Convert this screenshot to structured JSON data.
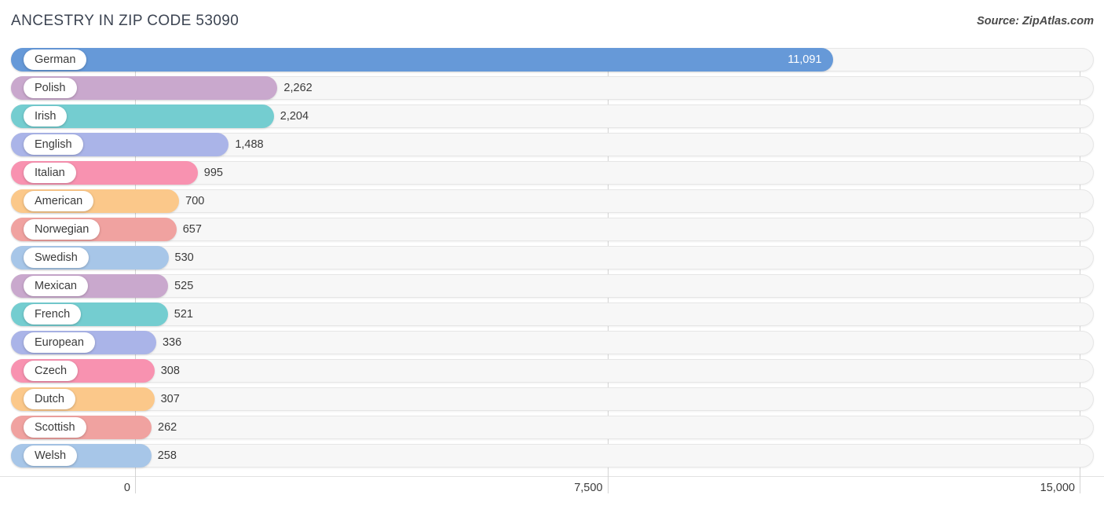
{
  "header": {
    "title": "ANCESTRY IN ZIP CODE 53090",
    "source": "Source: ZipAtlas.com"
  },
  "chart_data": {
    "type": "bar",
    "orientation": "horizontal",
    "title": "ANCESTRY IN ZIP CODE 53090",
    "xlabel": "",
    "ylabel": "",
    "xlim": [
      0,
      15000
    ],
    "xticks": [
      0,
      7500,
      15000
    ],
    "xtick_labels": [
      "0",
      "7,500",
      "15,000"
    ],
    "grid": true,
    "legend": "none",
    "categories": [
      "German",
      "Polish",
      "Irish",
      "English",
      "Italian",
      "American",
      "Norwegian",
      "Swedish",
      "Mexican",
      "French",
      "European",
      "Czech",
      "Dutch",
      "Scottish",
      "Welsh"
    ],
    "values": [
      11091,
      2262,
      2204,
      1488,
      995,
      700,
      657,
      530,
      525,
      521,
      336,
      308,
      307,
      262,
      258
    ],
    "value_labels": [
      "11,091",
      "2,262",
      "2,204",
      "1,488",
      "995",
      "700",
      "657",
      "530",
      "525",
      "521",
      "336",
      "308",
      "307",
      "262",
      "258"
    ],
    "colors": [
      "#6699d8",
      "#c9a8cd",
      "#74cdd0",
      "#aab4e8",
      "#f892b0",
      "#fbc88a",
      "#f0a2a0",
      "#a7c6e8",
      "#c9a8cd",
      "#74cdd0",
      "#aab4e8",
      "#f892b0",
      "#fbc88a",
      "#f0a2a0",
      "#a7c6e8"
    ],
    "bars": [
      {
        "label": "German",
        "value": 11091,
        "value_label": "11,091",
        "color": "#6699d8",
        "label_inside": true
      },
      {
        "label": "Polish",
        "value": 2262,
        "value_label": "2,262",
        "color": "#c9a8cd",
        "label_inside": false
      },
      {
        "label": "Irish",
        "value": 2204,
        "value_label": "2,204",
        "color": "#74cdd0",
        "label_inside": false
      },
      {
        "label": "English",
        "value": 1488,
        "value_label": "1,488",
        "color": "#aab4e8",
        "label_inside": false
      },
      {
        "label": "Italian",
        "value": 995,
        "value_label": "995",
        "color": "#f892b0",
        "label_inside": false
      },
      {
        "label": "American",
        "value": 700,
        "value_label": "700",
        "color": "#fbc88a",
        "label_inside": false
      },
      {
        "label": "Norwegian",
        "value": 657,
        "value_label": "657",
        "color": "#f0a2a0",
        "label_inside": false
      },
      {
        "label": "Swedish",
        "value": 530,
        "value_label": "530",
        "color": "#a7c6e8",
        "label_inside": false
      },
      {
        "label": "Mexican",
        "value": 525,
        "value_label": "525",
        "color": "#c9a8cd",
        "label_inside": false
      },
      {
        "label": "French",
        "value": 521,
        "value_label": "521",
        "color": "#74cdd0",
        "label_inside": false
      },
      {
        "label": "European",
        "value": 336,
        "value_label": "336",
        "color": "#aab4e8",
        "label_inside": false
      },
      {
        "label": "Czech",
        "value": 308,
        "value_label": "308",
        "color": "#f892b0",
        "label_inside": false
      },
      {
        "label": "Dutch",
        "value": 307,
        "value_label": "307",
        "color": "#fbc88a",
        "label_inside": false
      },
      {
        "label": "Scottish",
        "value": 262,
        "value_label": "262",
        "color": "#f0a2a0",
        "label_inside": false
      },
      {
        "label": "Welsh",
        "value": 258,
        "value_label": "258",
        "color": "#a7c6e8",
        "label_inside": false
      }
    ]
  }
}
